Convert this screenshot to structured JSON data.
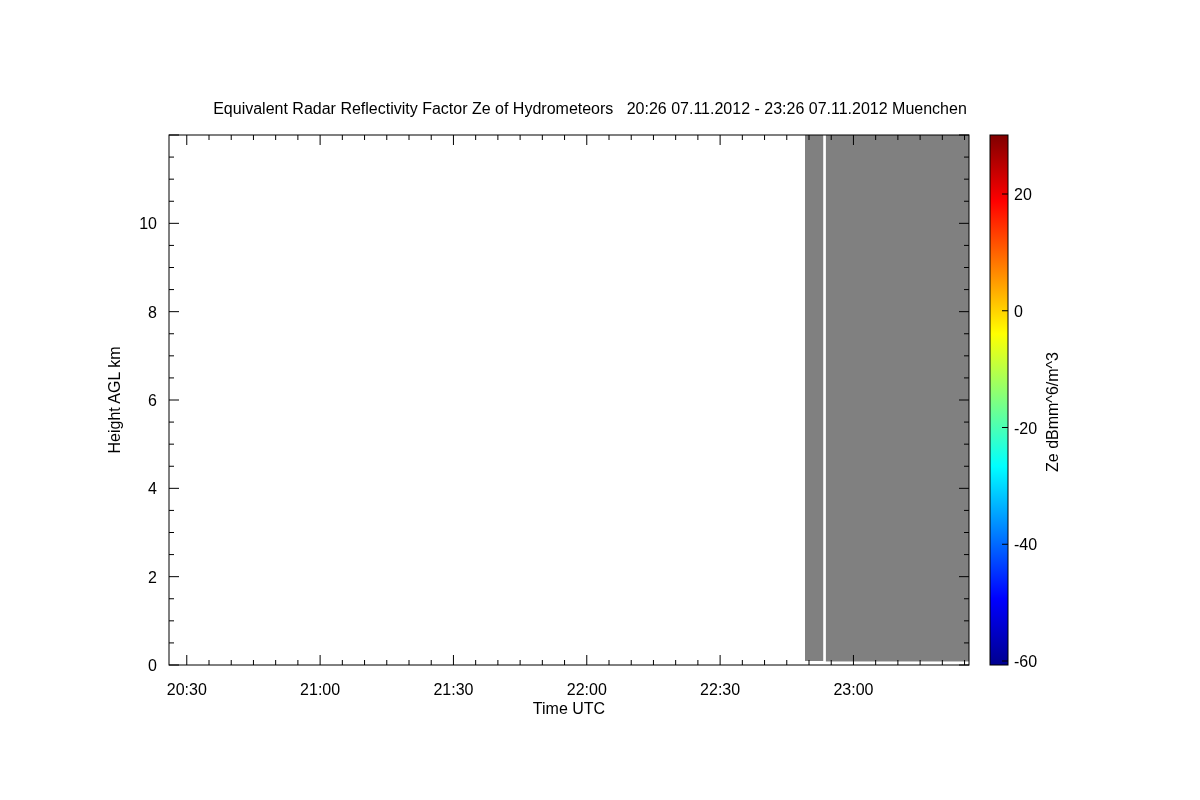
{
  "plot": {
    "title": "Equivalent Radar Reflectivity Factor Ze of Hydrometeors   20:26 07.11.2012 - 23:26 07.11.2012 Muenchen",
    "xlabel": "Time UTC",
    "ylabel": "Height AGL km",
    "x_tick_labels": [
      "20:30",
      "21:00",
      "21:30",
      "22:00",
      "22:30",
      "23:00"
    ],
    "y_tick_labels": [
      "10",
      "8",
      "6",
      "4",
      "2",
      "0"
    ]
  },
  "colorbar": {
    "label": "Ze dBmm^6/m^3",
    "tick_labels": [
      "20",
      "0",
      "-20",
      "-40",
      "-60"
    ]
  }
}
